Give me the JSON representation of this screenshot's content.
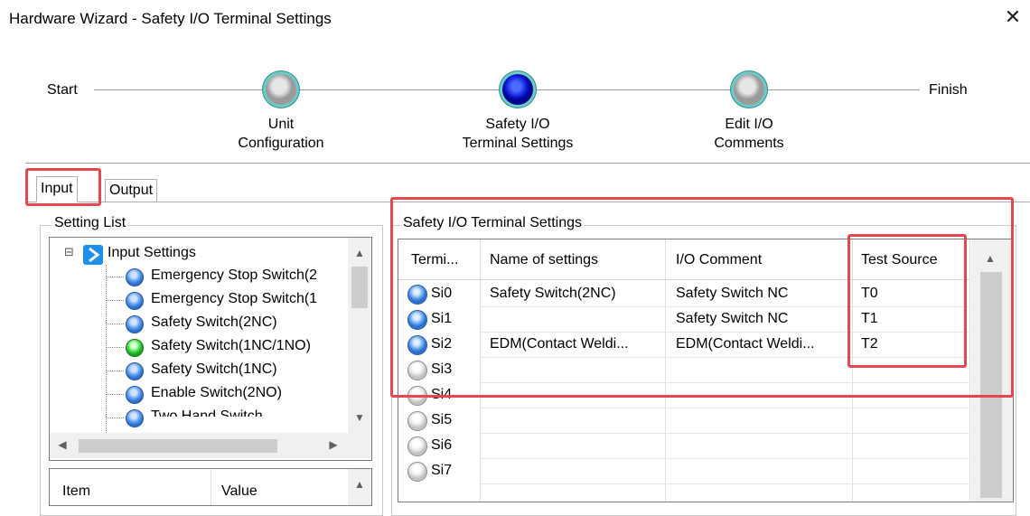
{
  "window": {
    "title": "Hardware Wizard - Safety I/O Terminal Settings",
    "close_glyph": "✕"
  },
  "wizard": {
    "start": "Start",
    "finish": "Finish",
    "steps": [
      {
        "line1": "Unit",
        "line2": "Configuration",
        "state": "inactive"
      },
      {
        "line1": "Safety I/O",
        "line2": "Terminal Settings",
        "state": "active"
      },
      {
        "line1": "Edit I/O",
        "line2": "Comments",
        "state": "inactive"
      }
    ]
  },
  "tabs": [
    {
      "label": "Input",
      "selected": true
    },
    {
      "label": "Output",
      "selected": false
    }
  ],
  "setting_list": {
    "title": "Setting List",
    "root": "Input Settings",
    "expander": "⊟",
    "items": [
      {
        "label": "Emergency Stop Switch(2",
        "icon": "blue"
      },
      {
        "label": "Emergency Stop Switch(1",
        "icon": "blue"
      },
      {
        "label": "Safety Switch(2NC)",
        "icon": "blue"
      },
      {
        "label": "Safety Switch(1NC/1NO)",
        "icon": "green"
      },
      {
        "label": "Safety Switch(1NC)",
        "icon": "blue"
      },
      {
        "label": "Enable Switch(2NO)",
        "icon": "blue"
      },
      {
        "label": "Two Hand Switch",
        "icon": "blue"
      }
    ],
    "scroll_up": "▲",
    "scroll_down": "▼",
    "scroll_left": "◀",
    "scroll_right": "▶"
  },
  "item_table": {
    "col_item": "Item",
    "col_value": "Value"
  },
  "terminal_settings": {
    "title": "Safety I/O Terminal Settings",
    "columns": [
      "Termi...",
      "Name of settings",
      "I/O Comment",
      "Test Source"
    ],
    "rows": [
      {
        "terminal": "Si0",
        "name": "Safety Switch(2NC)",
        "comment": "Safety Switch NC",
        "test_source": "T0",
        "state": "blue"
      },
      {
        "terminal": "Si1",
        "name": "",
        "comment": "Safety Switch NC",
        "test_source": "T1",
        "state": "blue"
      },
      {
        "terminal": "Si2",
        "name": "EDM(Contact Weldi...",
        "comment": "EDM(Contact Weldi...",
        "test_source": "T2",
        "state": "blue"
      },
      {
        "terminal": "Si3",
        "name": "",
        "comment": "",
        "test_source": "",
        "state": "gray"
      },
      {
        "terminal": "Si4",
        "name": "",
        "comment": "",
        "test_source": "",
        "state": "gray"
      },
      {
        "terminal": "Si5",
        "name": "",
        "comment": "",
        "test_source": "",
        "state": "gray"
      },
      {
        "terminal": "Si6",
        "name": "",
        "comment": "",
        "test_source": "",
        "state": "gray"
      },
      {
        "terminal": "Si7",
        "name": "",
        "comment": "",
        "test_source": "",
        "state": "gray"
      }
    ]
  },
  "colors": {
    "highlight": "#e5474e",
    "active_step": "#0a16d8"
  }
}
